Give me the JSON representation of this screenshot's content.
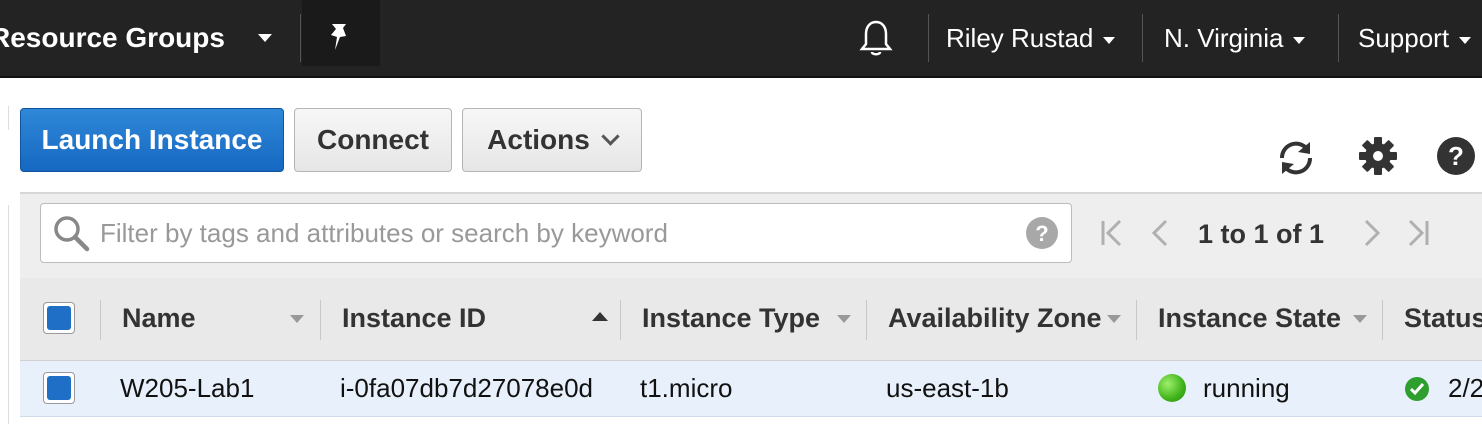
{
  "nav": {
    "resource_groups": "Resource Groups",
    "user": "Riley Rustad",
    "region": "N. Virginia",
    "support": "Support"
  },
  "toolbar": {
    "launch": "Launch Instance",
    "connect": "Connect",
    "actions": "Actions"
  },
  "filter": {
    "placeholder": "Filter by tags and attributes or search by keyword",
    "pagination": "1 to 1 of 1"
  },
  "table": {
    "columns": [
      "Name",
      "Instance ID",
      "Instance Type",
      "Availability Zone",
      "Instance State",
      "Status"
    ],
    "rows": [
      {
        "name": "W205-Lab1",
        "instance_id": "i-0fa07db7d27078e0d",
        "type": "t1.micro",
        "zone": "us-east-1b",
        "state": "running",
        "status_checks": "2/2"
      }
    ]
  },
  "colors": {
    "topbar": "#232323",
    "primary_button": "#1f6fc6",
    "running_green": "#3fb21a",
    "row_highlight": "#e8f0fb"
  },
  "icons": [
    "chevron-down-icon",
    "pin-icon",
    "bell-icon",
    "refresh-icon",
    "gear-icon",
    "help-icon",
    "search-icon",
    "first-page-icon",
    "prev-page-icon",
    "next-page-icon",
    "last-page-icon",
    "check-icon"
  ]
}
